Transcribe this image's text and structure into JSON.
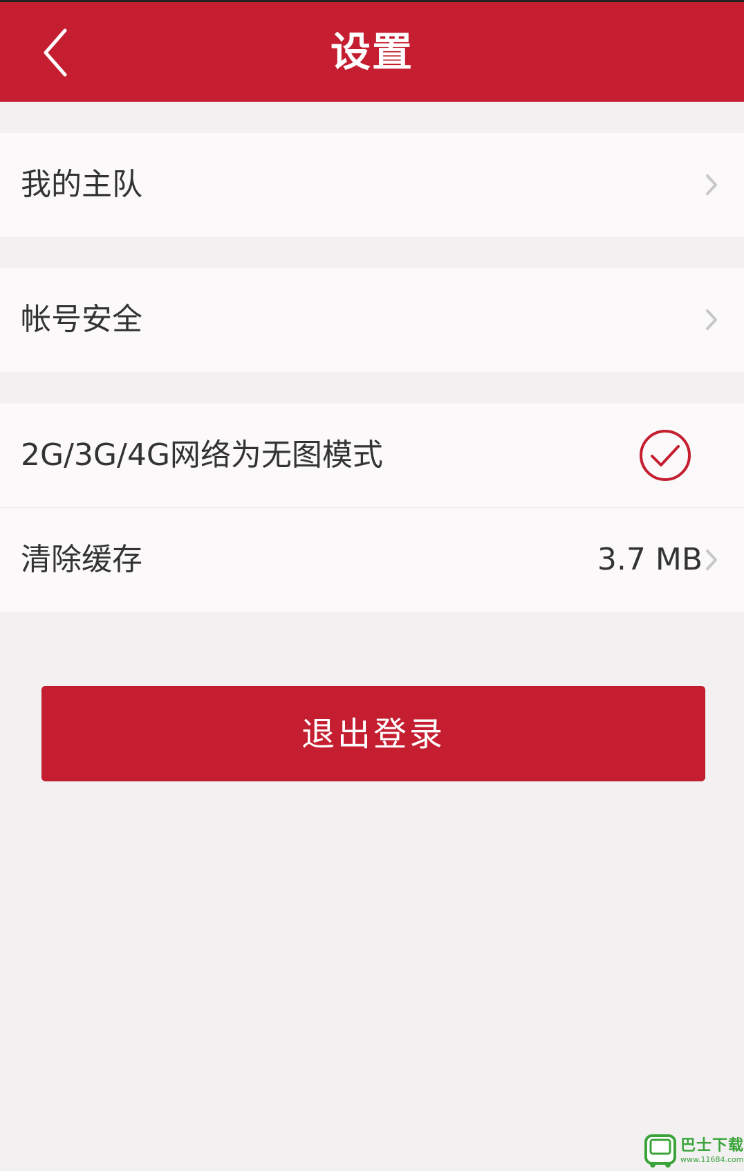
{
  "header": {
    "title": "设置",
    "back_icon": "back-arrow-icon"
  },
  "colors": {
    "brand": "#c41e30",
    "background": "#f3f0f1",
    "row": "#fbf9fa",
    "text": "#333333",
    "chevron": "#c7c7c7"
  },
  "settings": {
    "my_team": {
      "label": "我的主队"
    },
    "account_security": {
      "label": "帐号安全"
    },
    "no_image_mode": {
      "label": "2G/3G/4G网络为无图模式",
      "checked": true
    },
    "clear_cache": {
      "label": "清除缓存",
      "value": "3.7 MB"
    }
  },
  "logout": {
    "label": "退出登录"
  },
  "watermark": {
    "main": "巴士下载",
    "url": "www.11684.com"
  }
}
